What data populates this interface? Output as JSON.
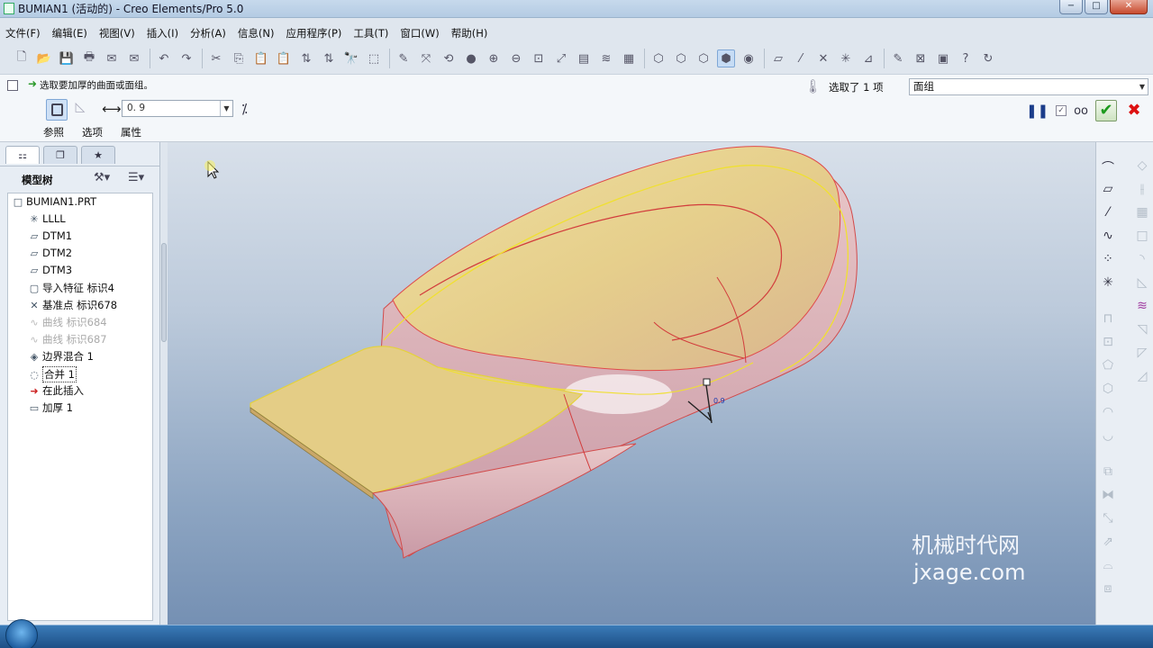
{
  "window": {
    "title": "BUMIAN1 (活动的) - Creo Elements/Pro 5.0",
    "buttons": [
      "−",
      "□",
      "✕"
    ]
  },
  "menu": [
    "文件(F)",
    "编辑(E)",
    "视图(V)",
    "插入(I)",
    "分析(A)",
    "信息(N)",
    "应用程序(P)",
    "工具(T)",
    "窗口(W)",
    "帮助(H)"
  ],
  "dashboard": {
    "prompt": "选取要加厚的曲面或面组。",
    "selected_text": "选取了 1 项",
    "filter": "面组",
    "thickness": "0. 9",
    "tabs": [
      "参照",
      "选项",
      "属性"
    ]
  },
  "navigator": {
    "title": "模型树",
    "items": [
      {
        "icon": "□",
        "label": "BUMIAN1.PRT"
      },
      {
        "icon": "✳",
        "label": "LLLL"
      },
      {
        "icon": "▱",
        "label": "DTM1"
      },
      {
        "icon": "▱",
        "label": "DTM2"
      },
      {
        "icon": "▱",
        "label": "DTM3"
      },
      {
        "icon": "▢",
        "label": "导入特征 标识4"
      },
      {
        "icon": "✕",
        "label": "基准点 标识678"
      },
      {
        "icon": "∿",
        "label": "曲线 标识684"
      },
      {
        "icon": "∿",
        "label": "曲线 标识687"
      },
      {
        "icon": "◈",
        "label": "边界混合 1"
      },
      {
        "icon": "◌",
        "label": "合并 1"
      },
      {
        "icon": "➜",
        "label": "在此插入"
      },
      {
        "icon": "▭",
        "label": "加厚 1"
      }
    ]
  },
  "viewport": {
    "dim_label": "0.9"
  },
  "watermark": {
    "line1": "机械时代网",
    "line2": "jxage.com"
  }
}
